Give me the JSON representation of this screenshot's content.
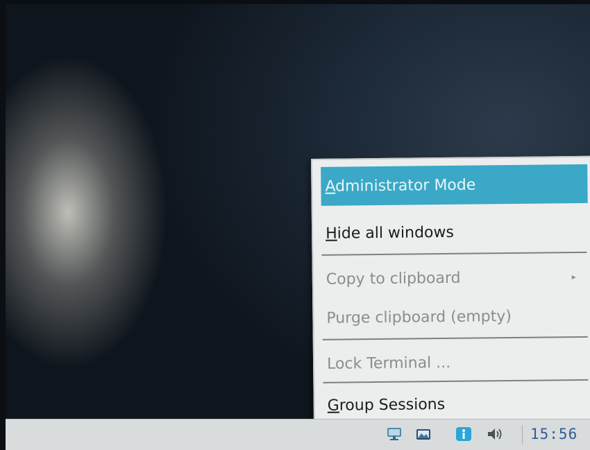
{
  "context_menu": {
    "items": [
      {
        "label": "Administrator Mode",
        "mnemonic": "A",
        "rest": "dministrator Mode",
        "state": "highlighted"
      },
      {
        "label": "Hide all windows",
        "mnemonic": "H",
        "rest": "ide all windows",
        "state": "enabled"
      },
      {
        "label": "Copy to clipboard",
        "state": "disabled",
        "has_submenu": true
      },
      {
        "label": "Purge clipboard (empty)",
        "state": "disabled"
      },
      {
        "label": "Lock Terminal ...",
        "state": "disabled"
      },
      {
        "label": "Group Sessions",
        "mnemonic": "G",
        "rest": "roup Sessions",
        "state": "enabled"
      }
    ],
    "highlight_color": "#3aa8c6",
    "submenu_arrow": "▸"
  },
  "taskbar": {
    "clock": "15:56",
    "tray_icons": [
      "network-icon",
      "folder-icon",
      "info-icon",
      "volume-icon"
    ]
  }
}
